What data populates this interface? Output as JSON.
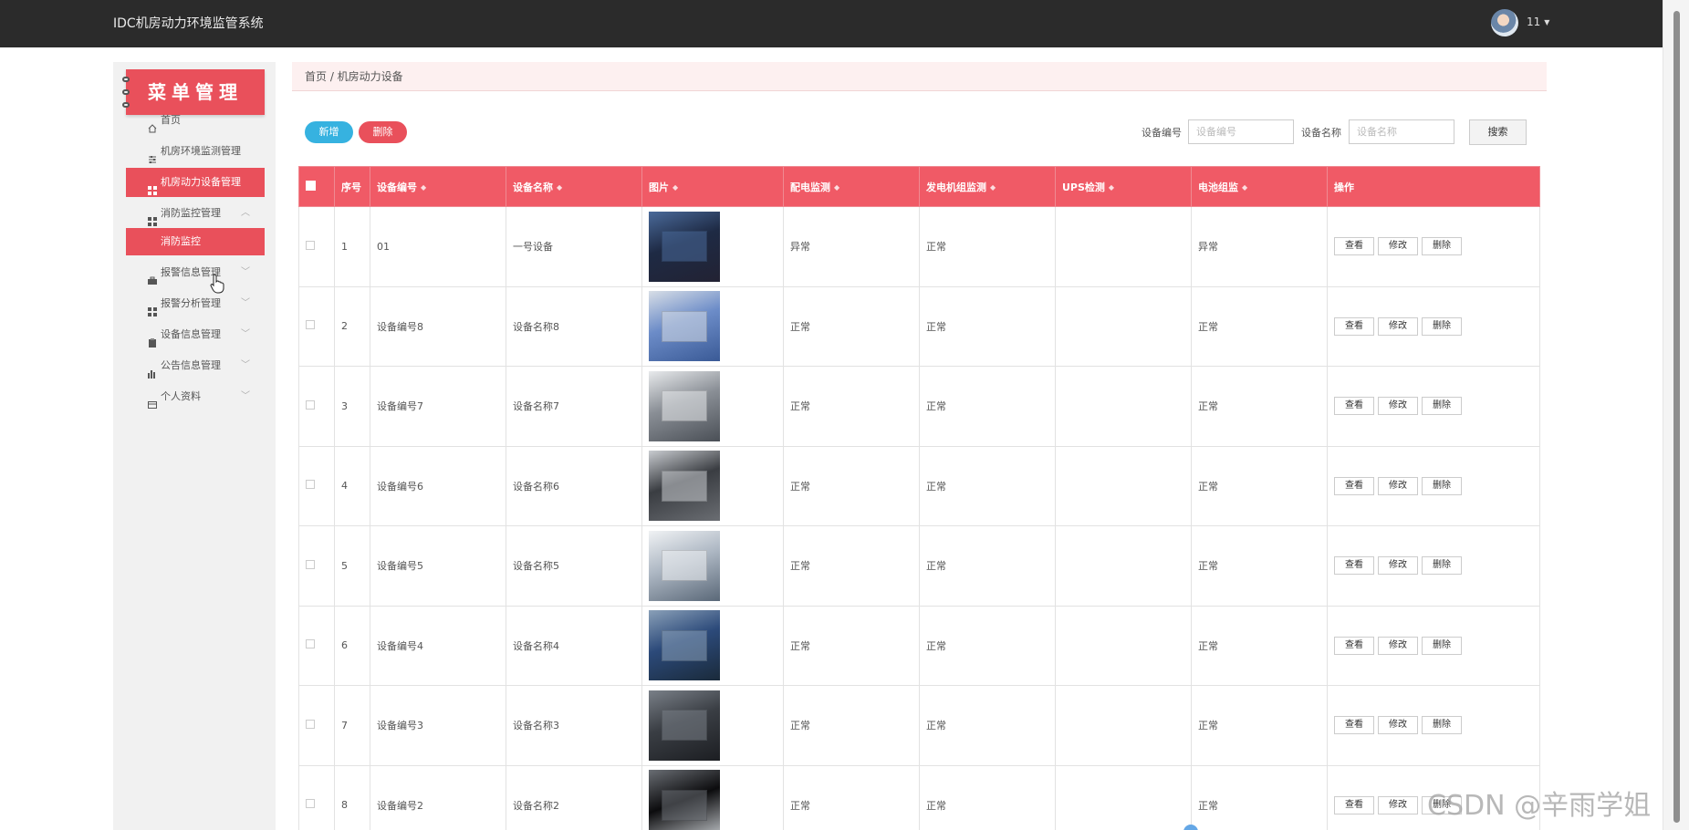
{
  "header": {
    "title": "IDC机房动力环境监管系统",
    "user": "11"
  },
  "sidebar": {
    "banner": "菜单管理",
    "items": [
      {
        "label": "首页",
        "icon": "home-icon"
      },
      {
        "label": "机房环境监测管理",
        "icon": "sliders-icon"
      },
      {
        "label": "机房动力设备管理",
        "icon": "grid-icon",
        "active": true
      },
      {
        "label": "消防监控管理",
        "icon": "grid-icon",
        "expanded": true
      },
      {
        "label": "报警信息管理",
        "icon": "briefcase-icon"
      },
      {
        "label": "报警分析管理",
        "icon": "grid-icon"
      },
      {
        "label": "设备信息管理",
        "icon": "clipboard-icon"
      },
      {
        "label": "公告信息管理",
        "icon": "chart-icon"
      },
      {
        "label": "个人资料",
        "icon": "card-icon"
      }
    ],
    "subitem": "消防监控"
  },
  "breadcrumb": "首页 / 机房动力设备",
  "toolbar": {
    "add": "新增",
    "delete": "删除",
    "search_label_1": "设备编号",
    "search_placeholder_1": "设备编号",
    "search_label_2": "设备名称",
    "search_placeholder_2": "设备名称",
    "search_btn": "搜索"
  },
  "table": {
    "headers": [
      "序号",
      "设备编号",
      "设备名称",
      "图片",
      "配电监测",
      "发电机组监测",
      "UPS检测",
      "电池组监",
      "操作"
    ],
    "actions": [
      "查看",
      "修改",
      "删除"
    ],
    "rows": [
      {
        "no": "1",
        "code": "01",
        "name": "一号设备",
        "power": "异常",
        "generator": "正常",
        "ups": "",
        "battery": "异常"
      },
      {
        "no": "2",
        "code": "设备编号8",
        "name": "设备名称8",
        "power": "正常",
        "generator": "正常",
        "ups": "",
        "battery": "正常"
      },
      {
        "no": "3",
        "code": "设备编号7",
        "name": "设备名称7",
        "power": "正常",
        "generator": "正常",
        "ups": "",
        "battery": "正常"
      },
      {
        "no": "4",
        "code": "设备编号6",
        "name": "设备名称6",
        "power": "正常",
        "generator": "正常",
        "ups": "",
        "battery": "正常"
      },
      {
        "no": "5",
        "code": "设备编号5",
        "name": "设备名称5",
        "power": "正常",
        "generator": "正常",
        "ups": "",
        "battery": "正常"
      },
      {
        "no": "6",
        "code": "设备编号4",
        "name": "设备名称4",
        "power": "正常",
        "generator": "正常",
        "ups": "",
        "battery": "正常"
      },
      {
        "no": "7",
        "code": "设备编号3",
        "name": "设备名称3",
        "power": "正常",
        "generator": "正常",
        "ups": "",
        "battery": "正常"
      },
      {
        "no": "8",
        "code": "设备编号2",
        "name": "设备名称2",
        "power": "正常",
        "generator": "正常",
        "ups": "",
        "battery": "正常"
      }
    ]
  },
  "watermark": "CSDN @辛雨学姐",
  "colors": {
    "accent": "#e9505b",
    "blue": "#36b2e0",
    "topbar": "#2b2b2b"
  }
}
